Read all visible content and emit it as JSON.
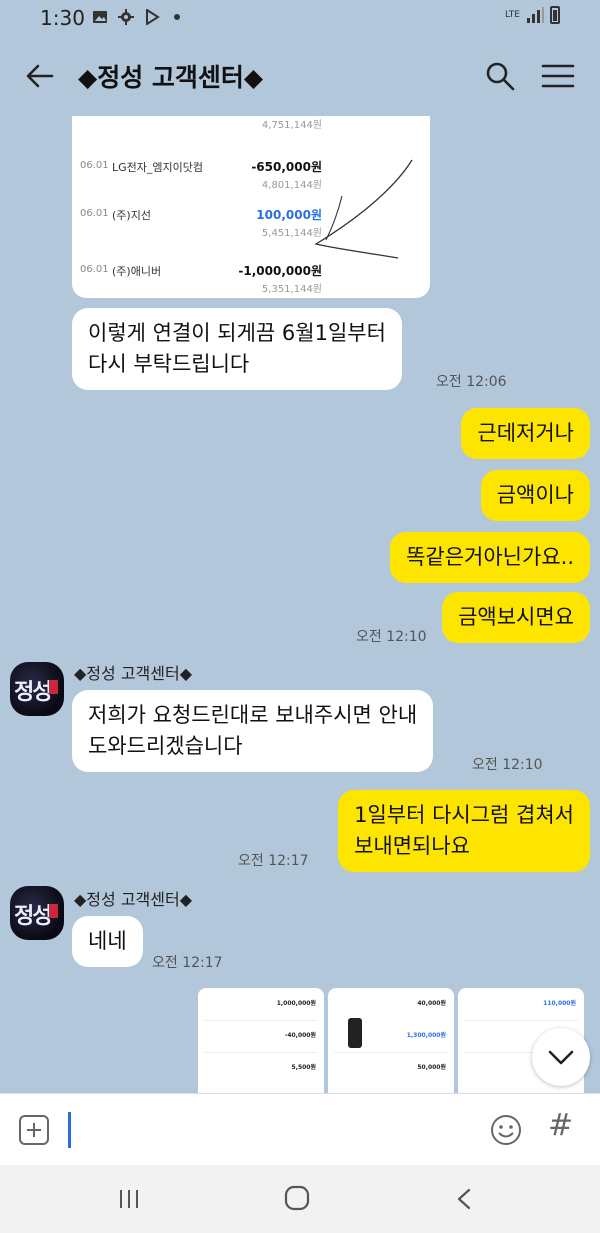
{
  "status_bar": {
    "time": "1:30",
    "network": "LTE",
    "icons": [
      "gallery-icon",
      "settings-icon",
      "play-store-icon",
      "notification-dot-icon",
      "signal-icon",
      "battery-icon"
    ]
  },
  "header": {
    "title": "◆정성 고객센터◆",
    "back_icon": "arrow-left-icon",
    "search_icon": "search-icon",
    "menu_icon": "hamburger-menu-icon"
  },
  "receipt": {
    "top_balance": "4,751,144원",
    "rows": [
      {
        "date": "06.01",
        "name": "LG전자_엠지이닷컴",
        "amount": "-650,000원",
        "balance": "4,801,144원",
        "color": "#111111"
      },
      {
        "date": "06.01",
        "name": "(주)지선",
        "amount": "100,000원",
        "balance": "5,451,144원",
        "color": "#2a6ee6"
      },
      {
        "date": "06.01",
        "name": "(주)애니버",
        "amount": "-1,000,000원",
        "balance": "5,351,144원",
        "color": "#111111"
      }
    ]
  },
  "messages": [
    {
      "type": "in",
      "text": [
        "이렇게 연결이 되게끔 6월1일부터",
        "다시 부탁드립니다"
      ],
      "time": "오전 12:06"
    },
    {
      "type": "out",
      "text": [
        "근데저거나"
      ]
    },
    {
      "type": "out",
      "text": [
        "금액이나"
      ]
    },
    {
      "type": "out",
      "text": [
        "똑같은거아닌가요.."
      ]
    },
    {
      "type": "out",
      "text": [
        "금액보시면요"
      ],
      "time": "오전 12:10"
    },
    {
      "type": "in",
      "sender": "◆정성 고객센터◆",
      "text": [
        "저희가 요청드린대로 보내주시면 안내",
        "도와드리겠습니다"
      ],
      "time": "오전 12:10"
    },
    {
      "type": "out",
      "text": [
        "1일부터 다시그럼 겹쳐서",
        "보내면되나요"
      ],
      "time": "오전 12:17"
    },
    {
      "type": "in",
      "sender": "◆정성 고객센터◆",
      "text": [
        "네네"
      ],
      "time": "오전 12:17"
    }
  ],
  "avatar_label": "정성",
  "thumbnails": [
    {
      "amounts": [
        "1,000,000원",
        "-40,000원",
        "5,500원"
      ]
    },
    {
      "amounts": [
        "40,000원",
        "1,300,000원",
        "50,000원"
      ]
    },
    {
      "amounts": [
        "110,000원",
        "",
        ""
      ]
    }
  ],
  "input_bar": {
    "plus_icon": "plus-square-icon",
    "emoji_icon": "emoji-icon",
    "hash_label": "#"
  },
  "scroll_down_icon": "chevron-down-icon",
  "nav_bar": {
    "icons": [
      "recent-apps-icon",
      "home-icon",
      "back-icon"
    ]
  },
  "colors": {
    "chat_bg": "#b2c7da",
    "my_bubble": "#fee500",
    "their_bubble": "#ffffff",
    "blue_amount": "#2a6ee6"
  }
}
